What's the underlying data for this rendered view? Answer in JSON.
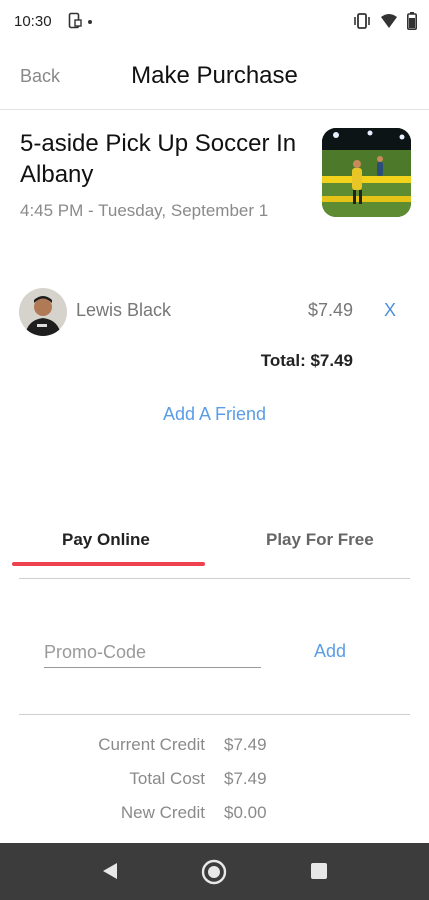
{
  "status_bar": {
    "time": "10:30",
    "icons": [
      "screenshot-notification-icon",
      "notification-dot",
      "vibrate-icon",
      "wifi-icon",
      "battery-icon"
    ]
  },
  "header": {
    "back_label": "Back",
    "title": "Make Purchase"
  },
  "event": {
    "title": "5-aside Pick Up Soccer In Albany",
    "datetime": "4:45 PM - Tuesday, September 1",
    "thumbnail_icon": "soccer-field-photo"
  },
  "attendee": {
    "name": "Lewis Black",
    "price": "$7.49",
    "remove_label": "X"
  },
  "total_label": "Total: $7.49",
  "add_friend_label": "Add A Friend",
  "tabs": [
    {
      "label": "Pay Online",
      "active": true
    },
    {
      "label": "Play For Free",
      "active": false
    }
  ],
  "promo": {
    "placeholder": "Promo-Code",
    "value": "",
    "add_label": "Add"
  },
  "credits": [
    {
      "label": "Current Credit",
      "value": "$7.49"
    },
    {
      "label": "Total Cost",
      "value": "$7.49"
    },
    {
      "label": "New Credit",
      "value": "$0.00"
    }
  ],
  "colors": {
    "accent_blue": "#5b9de6",
    "tab_underline": "#ef4050",
    "nav_bar": "#3c3c3c"
  }
}
